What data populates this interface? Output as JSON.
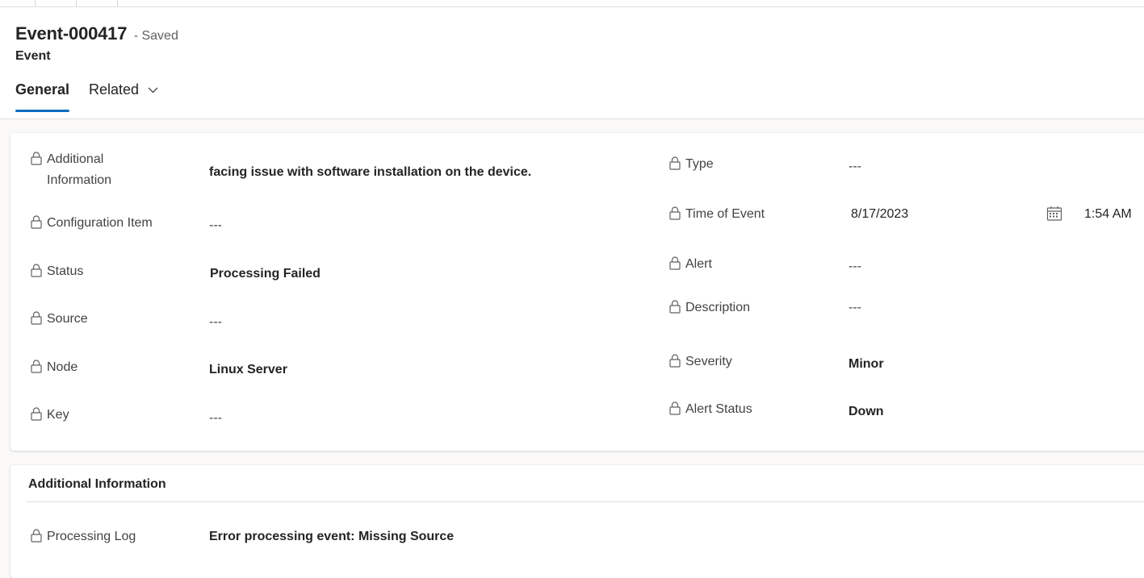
{
  "header": {
    "title": "Event-000417",
    "saved_status": "- Saved",
    "entity_type": "Event"
  },
  "tabs": [
    {
      "label": "General"
    },
    {
      "label": "Related"
    }
  ],
  "icons": {
    "lock": "lock-icon",
    "calendar": "calendar-icon",
    "chevron": "chevron-down-icon"
  },
  "colors": {
    "accent": "#0f6cbd",
    "background": "#faf9f8"
  },
  "general": {
    "left": [
      {
        "label_line1": "Additional",
        "label_line2": "Information",
        "value": "facing issue with software installation on the device."
      },
      {
        "label": "Configuration Item",
        "value": "---"
      },
      {
        "label": "Status",
        "value": "Processing Failed"
      },
      {
        "label": "Source",
        "value": "---"
      },
      {
        "label": "Node",
        "value": "Linux Server"
      },
      {
        "label": "Key",
        "value": "---"
      }
    ],
    "right": [
      {
        "label": "Type",
        "value": "---"
      },
      {
        "label": "Time of Event",
        "date": "8/17/2023",
        "time": "1:54 AM"
      },
      {
        "label": "Alert",
        "value": "---"
      },
      {
        "label": "Description",
        "value": "---"
      },
      {
        "label": "Severity",
        "value": "Minor"
      },
      {
        "label": "Alert Status",
        "value": "Down"
      }
    ]
  },
  "additional_section": {
    "title": "Additional Information",
    "fields": [
      {
        "label": "Processing Log",
        "value": "Error processing event: Missing Source"
      }
    ]
  }
}
